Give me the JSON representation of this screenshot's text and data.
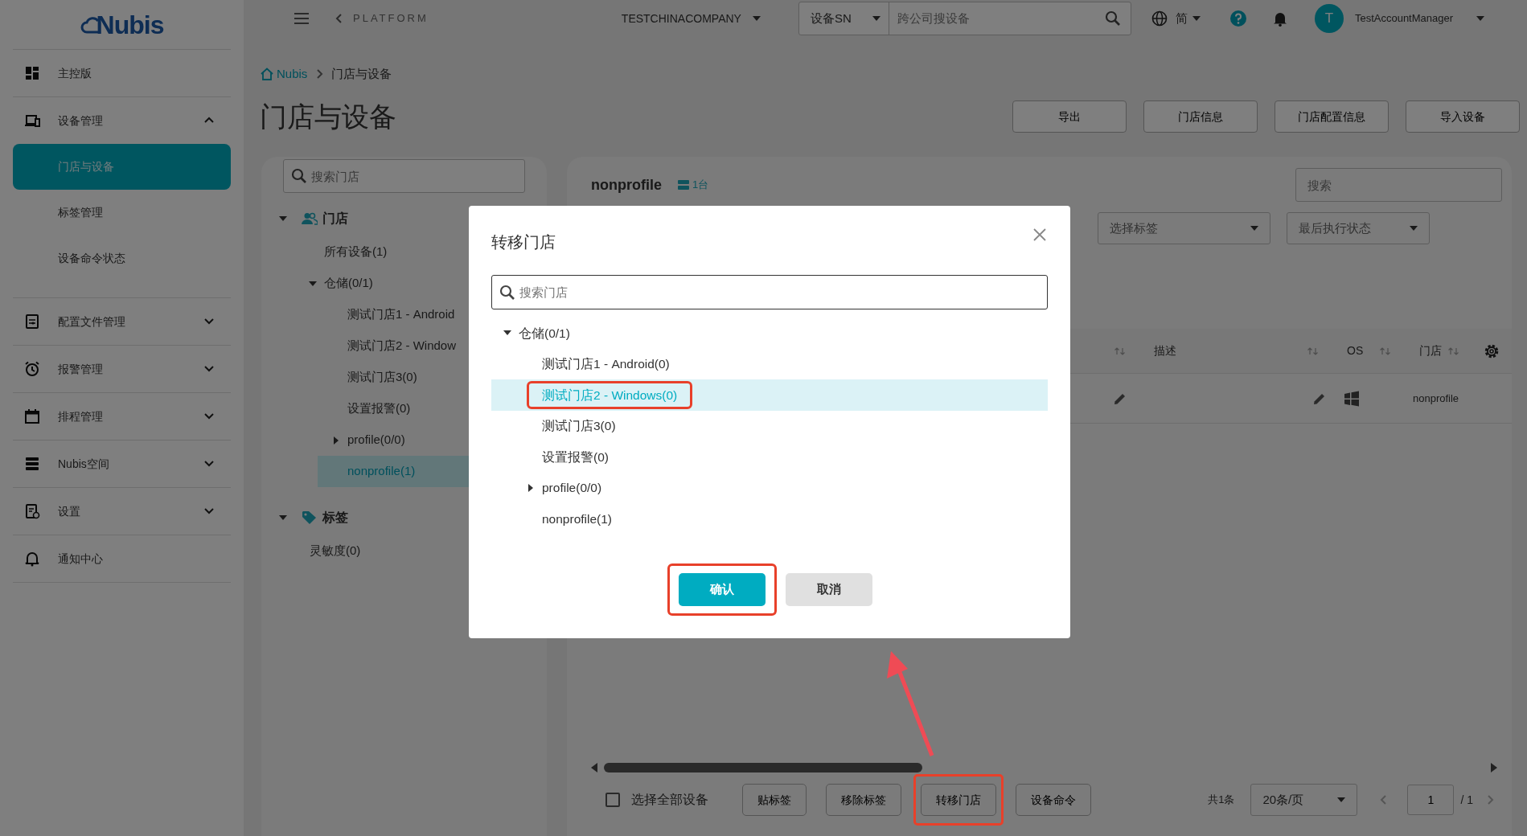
{
  "logo": {
    "text": "Nubis"
  },
  "topbar": {
    "back_label": "PLATFORM",
    "company": "TESTCHINACOMPANY",
    "search_scope": "设备SN",
    "search": {
      "placeholder": "跨公司搜设备"
    },
    "language": "简",
    "avatar": "T",
    "user": "TestAccountManager"
  },
  "sidebar": {
    "items": [
      {
        "label": "主控版",
        "kind": "link",
        "selected": false
      },
      {
        "label": "设备管理",
        "kind": "group",
        "expanded": true,
        "children": [
          {
            "label": "门店与设备",
            "selected": true
          },
          {
            "label": "标签管理",
            "selected": false
          },
          {
            "label": "设备命令状态",
            "selected": false
          }
        ]
      },
      {
        "label": "配置文件管理",
        "kind": "group",
        "expanded": false
      },
      {
        "label": "报警管理",
        "kind": "group",
        "expanded": false
      },
      {
        "label": "排程管理",
        "kind": "group",
        "expanded": false
      },
      {
        "label": "Nubis空间",
        "kind": "group",
        "expanded": false
      },
      {
        "label": "设置",
        "kind": "group",
        "expanded": false
      },
      {
        "label": "通知中心",
        "kind": "link",
        "selected": false
      }
    ]
  },
  "breadcrumb": [
    {
      "label": "Nubis",
      "kind": "home"
    },
    {
      "label": "门店与设备",
      "kind": "current"
    }
  ],
  "page_title": "门店与设备",
  "actions": [
    "导出",
    "门店信息",
    "门店配置信息",
    "导入设备"
  ],
  "store_tree": {
    "search": {
      "placeholder": "搜索门店"
    },
    "sections": [
      {
        "label": "门店",
        "kind": "stores",
        "expanded": true,
        "nodes": [
          {
            "label": "所有设备(1)",
            "kind": "leaf",
            "selected": false
          },
          {
            "label": "仓储(0/1)",
            "kind": "folder",
            "expanded": true,
            "selected": false,
            "children": [
              {
                "label": "测试门店1 - Android",
                "kind": "leaf",
                "selected": false
              },
              {
                "label": "测试门店2 - Window",
                "kind": "leaf",
                "selected": false
              },
              {
                "label": "测试门店3(0)",
                "kind": "leaf",
                "selected": false
              },
              {
                "label": "设置报警(0)",
                "kind": "leaf",
                "selected": false
              },
              {
                "label": "profile(0/0)",
                "kind": "folder",
                "expanded": false,
                "selected": false
              },
              {
                "label": "nonprofile(1)",
                "kind": "leaf",
                "selected": true
              }
            ]
          }
        ]
      },
      {
        "label": "标签",
        "kind": "tags",
        "expanded": true,
        "nodes": [
          {
            "label": "灵敏度(0)",
            "kind": "leaf",
            "selected": false
          }
        ]
      }
    ]
  },
  "device_panel": {
    "title": "nonprofile",
    "count": "1台",
    "search": {
      "placeholder": "搜索"
    },
    "filters": [
      {
        "placeholder": "选择标签"
      },
      {
        "placeholder": "最后执行状态"
      }
    ],
    "table": {
      "columns": [
        {
          "label": "描述"
        },
        {
          "label": "OS"
        },
        {
          "label": "门店"
        }
      ],
      "rows": [
        {
          "store": "nonprofile"
        }
      ]
    }
  },
  "bottom_bar": {
    "select_all": {
      "label": "选择全部设备",
      "checked": false
    },
    "buttons": [
      {
        "label": "贴标签",
        "annotated": false
      },
      {
        "label": "移除标签",
        "annotated": false
      },
      {
        "label": "转移门店",
        "annotated": true
      },
      {
        "label": "设备命令",
        "annotated": false
      }
    ],
    "total": "共1条",
    "page_size": "20条/页",
    "page": "1",
    "page_count": "/ 1"
  },
  "dialog": {
    "title": "转移门店",
    "search": {
      "placeholder": "搜索门店"
    },
    "tree": [
      {
        "label": "仓储(0/1)",
        "kind": "folder",
        "expanded": true,
        "selected": false,
        "annotated": false,
        "children": [
          {
            "label": "测试门店1 - Android(0)",
            "kind": "leaf",
            "selected": false,
            "annotated": false
          },
          {
            "label": "测试门店2 - Windows(0)",
            "kind": "leaf",
            "selected": true,
            "annotated": true
          },
          {
            "label": "测试门店3(0)",
            "kind": "leaf",
            "selected": false,
            "annotated": false
          },
          {
            "label": "设置报警(0)",
            "kind": "leaf",
            "selected": false,
            "annotated": false
          },
          {
            "label": "profile(0/0)",
            "kind": "folder",
            "expanded": false,
            "selected": false,
            "annotated": false
          },
          {
            "label": "nonprofile(1)",
            "kind": "leaf",
            "selected": false,
            "annotated": false
          }
        ]
      }
    ],
    "buttons": [
      {
        "label": "确认",
        "kind": "primary",
        "annotated": true
      },
      {
        "label": "取消",
        "kind": "secondary",
        "annotated": false
      }
    ]
  }
}
